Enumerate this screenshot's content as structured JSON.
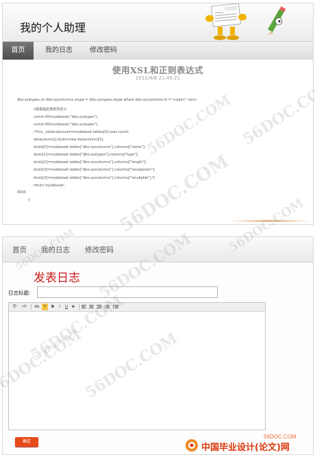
{
  "screen1": {
    "app_title": "我的个人助理",
    "nav": [
      {
        "label": "首页"
      },
      {
        "label": "我的日志"
      },
      {
        "label": "修改密码"
      }
    ],
    "article": {
      "title": "使用XSL和正则表达式",
      "date": "2011/4/6 21:45:21",
      "code_lines": [
        "dbo.systypes on dbo.syscolumns.xtype = dbo.systypes.xtype where dbo.syscolumns.id =\"+spid+\" com)",
        "//获取指定表的列定义",
        "comm.fill(mydataset,\"dbo.systypes\");",
        "comm.fill(mydataset,\"dbo.systypes\");",
        "/*this._tablecolscount=mydataset.tables[0].rows.count;",
        "datacolumn[] dcols=new datacolumn[5];",
        "dcols[0]=mydataset.tables[\"dbo.syscolumns\"].columns[\"name\"];",
        "dcols[1]=mydataset.tables[\"dbo.systypes\"].columns[\"type\"];",
        "dcols[2]=mydataset.tables[\"dbo.syscolumns\"].columns[\"length\"];",
        "dcols[3]=mydataset.tables[\"dbo.syscolumns\"].columns[\"isoutparam\"];",
        "dcols[3]=mydataset.tables[\"dbo.syscolumns\"].columns[\"isnullable\"];*/",
        "return mydataset;",
        "0000",
        "}"
      ]
    }
  },
  "screen2": {
    "nav": [
      {
        "label": "首页"
      },
      {
        "label": "我的日志"
      },
      {
        "label": "修改密码"
      }
    ],
    "post_title": "发表日志",
    "log_title_label": "日志标题:",
    "log_title_value": "",
    "toolbar": {
      "font_family": "字·",
      "font_size": "тT·",
      "text_color": "Ab",
      "highlight": "T",
      "bold": "B",
      "italic": "I",
      "underline": "U",
      "strike": "S"
    },
    "submit_label": "确定"
  },
  "watermark": "56DOC.COM",
  "footer": {
    "site": "56DOC.COM",
    "text": "中国毕业设计(论文)网"
  },
  "colors": {
    "title_red": "#cc1b1b",
    "button_orange": "#e64a19",
    "nav_active": "#555555"
  }
}
